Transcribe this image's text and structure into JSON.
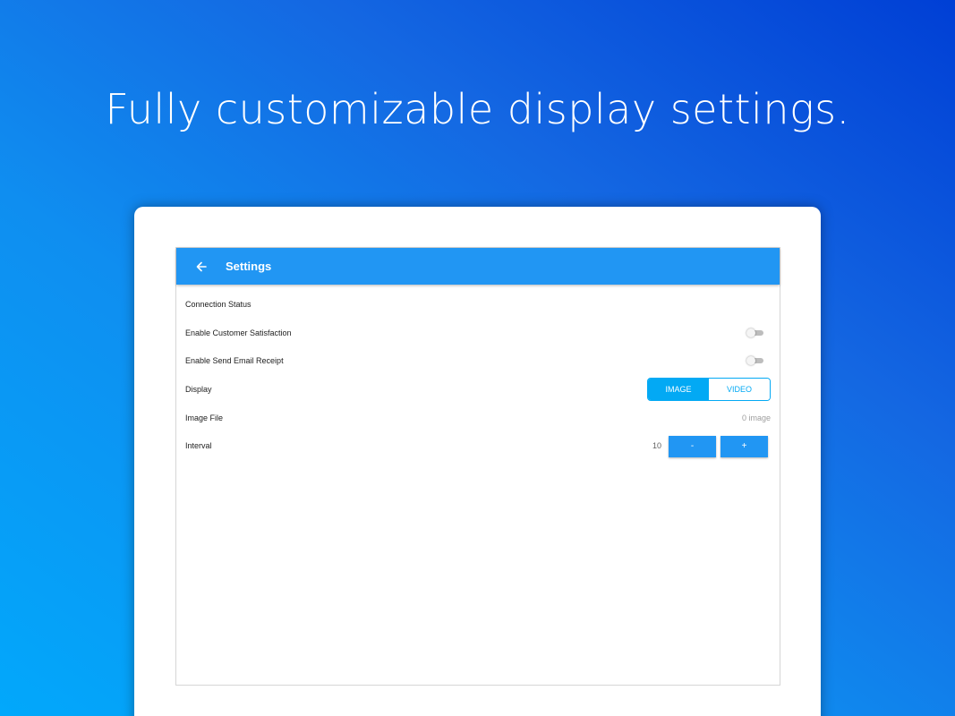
{
  "headline": "Fully customizable display settings.",
  "app": {
    "title": "Settings",
    "back_icon": "arrow-left-icon",
    "accent_color": "#2196f3"
  },
  "settings": {
    "connection_status": {
      "label": "Connection Status"
    },
    "customer_satisfaction": {
      "label": "Enable Customer Satisfaction",
      "enabled": false
    },
    "send_email_receipt": {
      "label": "Enable Send Email Receipt",
      "enabled": false
    },
    "display": {
      "label": "Display",
      "options": [
        "IMAGE",
        "VIDEO"
      ],
      "selected": "IMAGE"
    },
    "image_file": {
      "label": "Image File",
      "value": "0 image"
    },
    "interval": {
      "label": "Interval",
      "value": "10",
      "minus_label": "-",
      "plus_label": "+"
    }
  }
}
